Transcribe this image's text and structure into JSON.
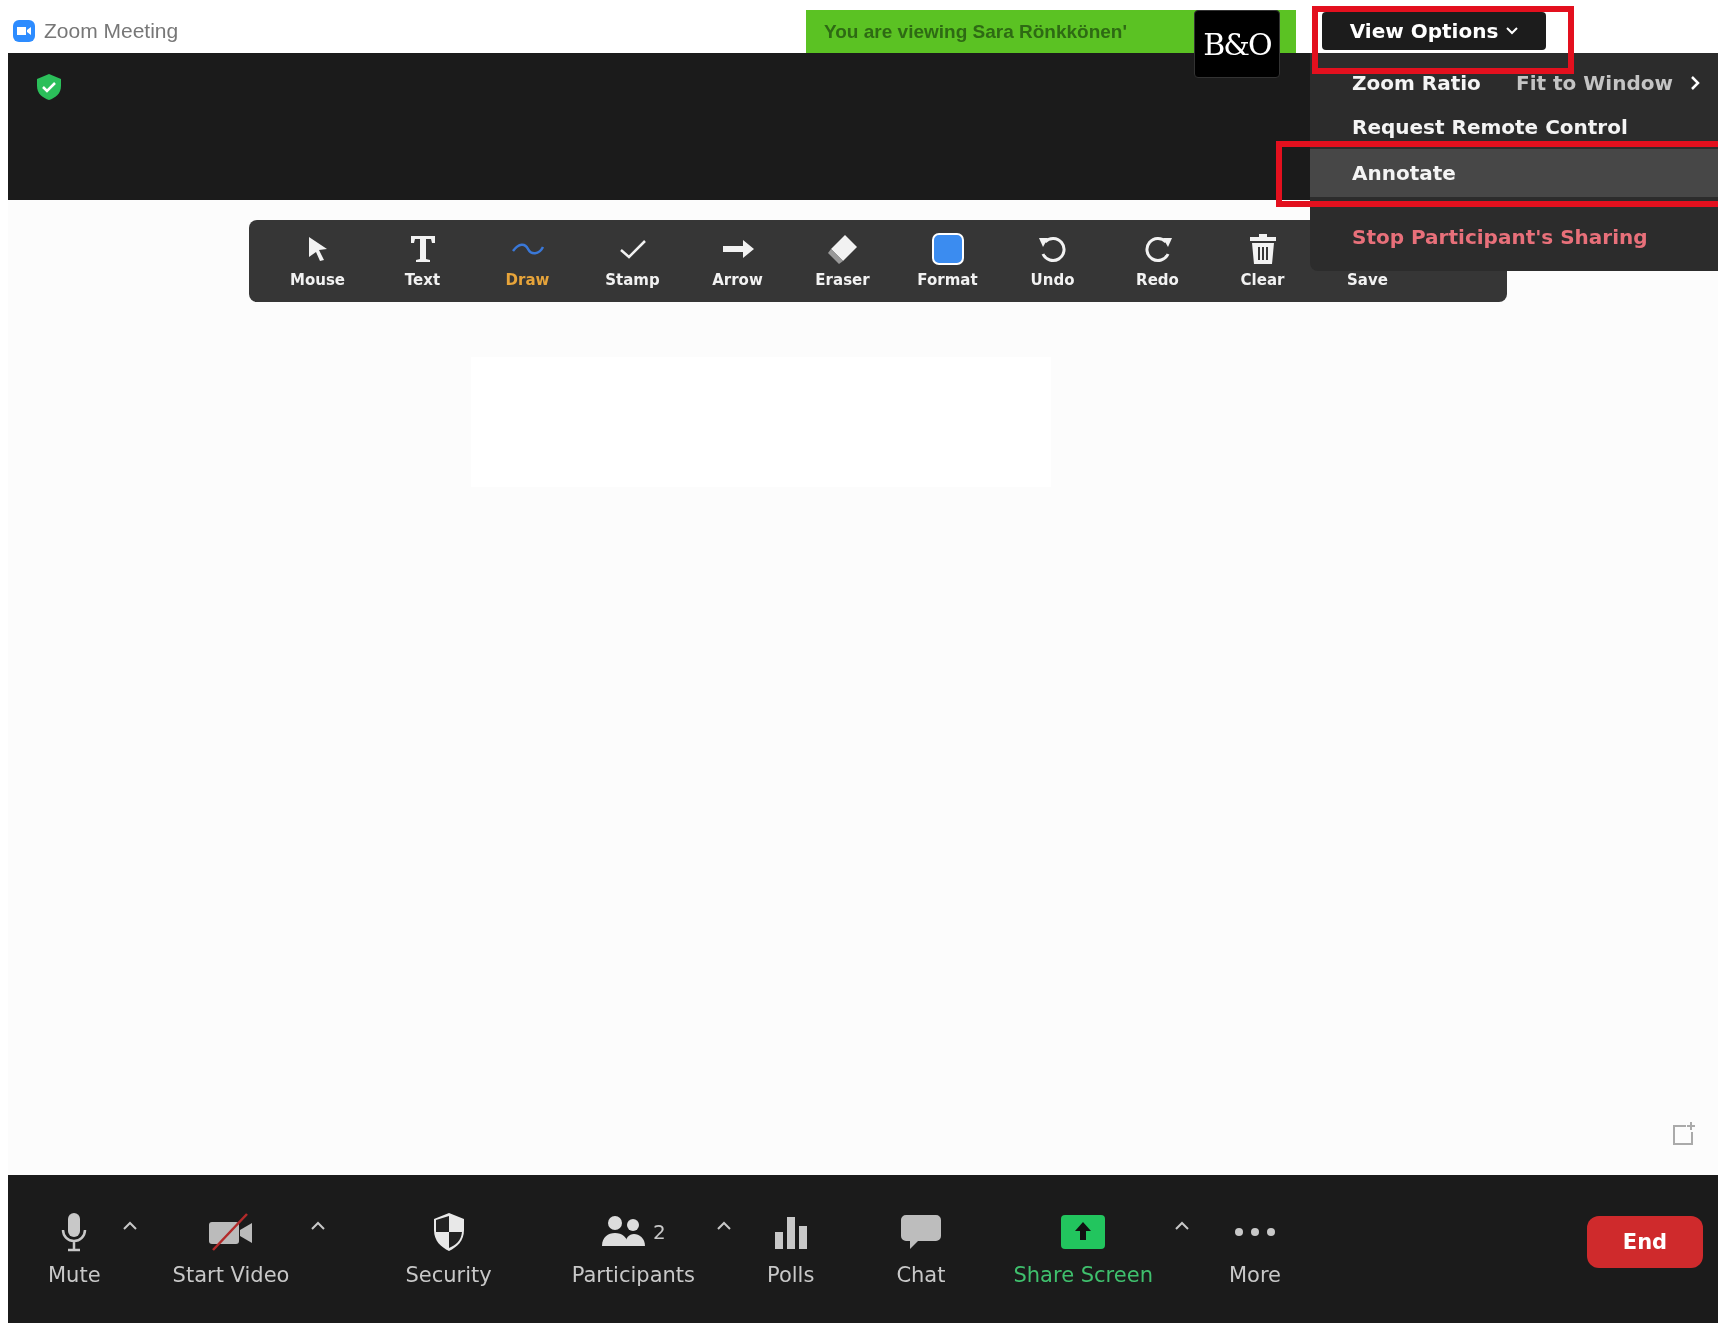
{
  "window": {
    "title": "Zoom Meeting"
  },
  "banner": {
    "text": "You are viewing Sara Rönkkönen'"
  },
  "logo": {
    "text": "B&O"
  },
  "view_options": {
    "label": "View Options"
  },
  "menu": {
    "items": [
      {
        "kind": "submenu",
        "label": "Zoom Ratio",
        "value": "Fit to Window",
        "selected": false
      },
      {
        "kind": "item",
        "label": "Request Remote Control",
        "selected": false
      },
      {
        "kind": "item",
        "label": "Annotate",
        "selected": true
      },
      {
        "kind": "danger",
        "label": "Stop Participant's Sharing",
        "selected": false
      }
    ]
  },
  "annotation_toolbar": {
    "tools": [
      {
        "label": "Mouse",
        "selected": false
      },
      {
        "label": "Text",
        "selected": false
      },
      {
        "label": "Draw",
        "selected": true
      },
      {
        "label": "Stamp",
        "selected": false
      },
      {
        "label": "Arrow",
        "selected": false
      },
      {
        "label": "Eraser",
        "selected": false
      },
      {
        "label": "Format",
        "selected": false
      },
      {
        "label": "Undo",
        "selected": false
      },
      {
        "label": "Redo",
        "selected": false
      },
      {
        "label": "Clear",
        "selected": false
      },
      {
        "label": "Save",
        "selected": false
      }
    ]
  },
  "controls": [
    {
      "kind": "standard",
      "label": "Mute",
      "has_menu": true
    },
    {
      "kind": "standard",
      "label": "Start Video",
      "has_menu": true
    },
    {
      "kind": "standard",
      "label": "Security",
      "has_menu": false
    },
    {
      "kind": "standard",
      "label": "Participants",
      "count": "2",
      "has_menu": true
    },
    {
      "kind": "standard",
      "label": "Polls",
      "has_menu": false
    },
    {
      "kind": "standard",
      "label": "Chat",
      "has_menu": false
    },
    {
      "kind": "share",
      "label": "Share Screen",
      "has_menu": true
    },
    {
      "kind": "standard",
      "label": "More",
      "has_menu": false
    }
  ],
  "end_button": {
    "label": "End"
  }
}
